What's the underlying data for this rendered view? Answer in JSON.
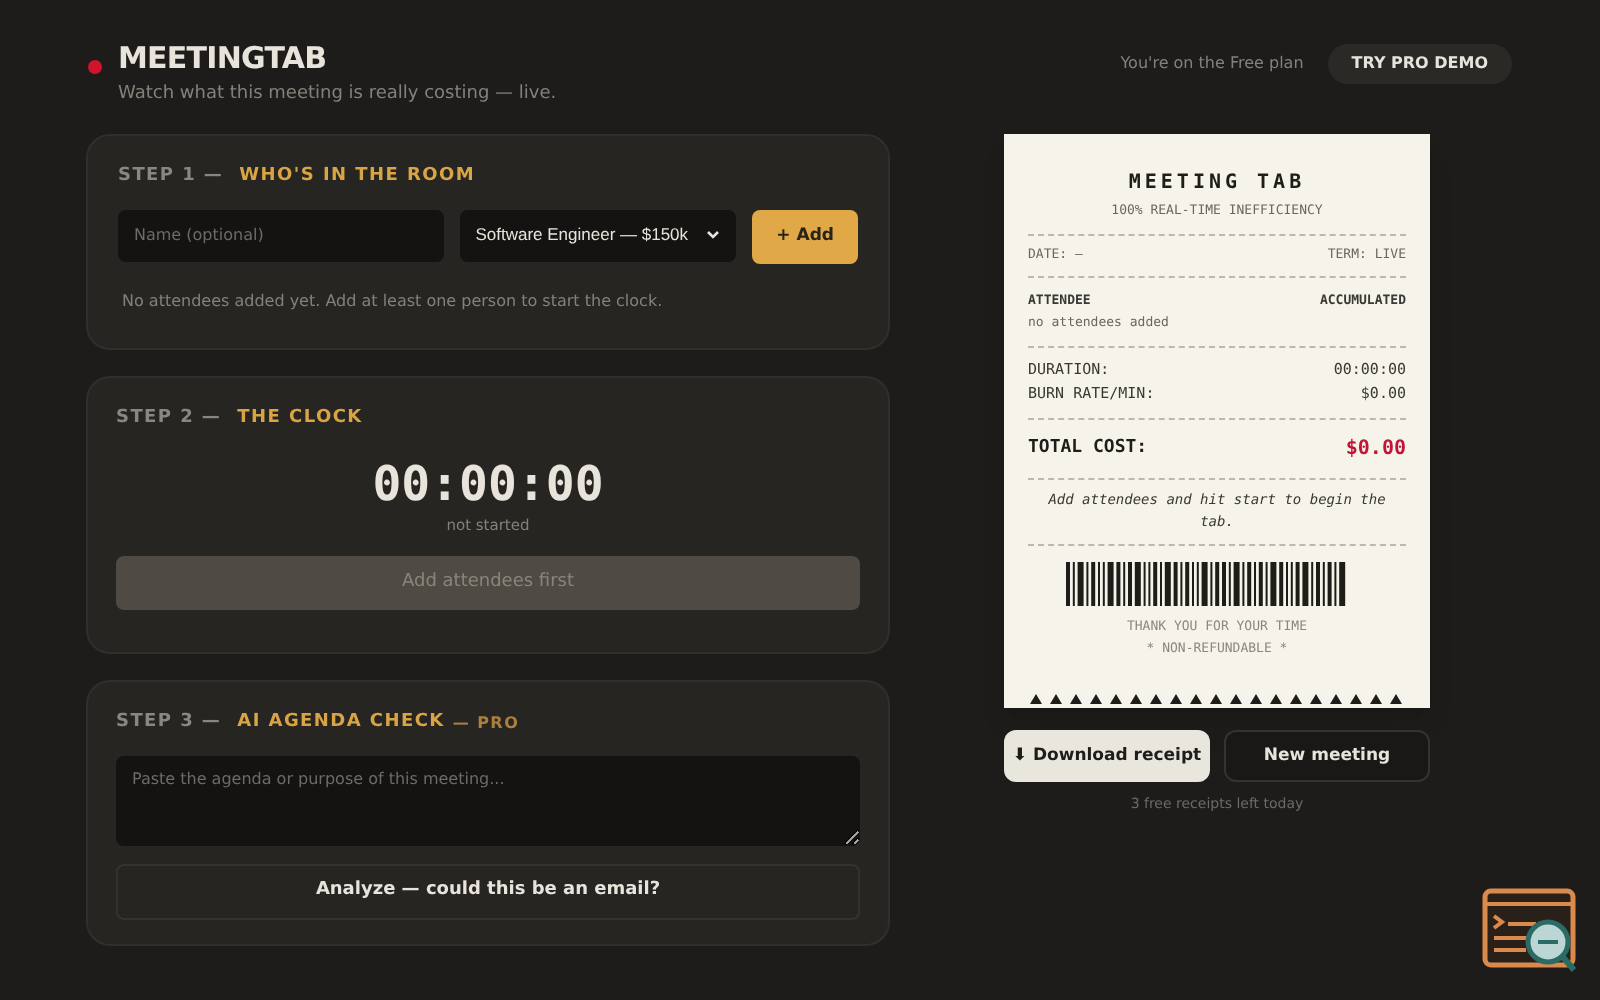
{
  "header": {
    "title": "MEETINGTAB",
    "tagline": "Watch what this meeting is really costing — live.",
    "plan_note": "You're on the Free plan",
    "pro_button": "TRY PRO DEMO"
  },
  "step1": {
    "step": "STEP 1 —",
    "title": "WHO'S IN THE ROOM",
    "name_placeholder": "Name (optional)",
    "role_value": "Software Engineer — $150k",
    "add_button": "+ Add",
    "hint": "No attendees added yet. Add at least one person to start the clock."
  },
  "step2": {
    "step": "STEP 2 —",
    "title": "THE CLOCK",
    "timer": "00:00:00",
    "status": "not started",
    "start_button": "Add attendees first",
    "start_disabled": true
  },
  "step3": {
    "step": "STEP 3 —",
    "title": "AI AGENDA CHECK",
    "badge": "— PRO",
    "agenda_placeholder": "Paste the agenda or purpose of this meeting...",
    "analyze_button": "Analyze — could this be an email?"
  },
  "receipt": {
    "title": "MEETING TAB",
    "subtitle": "100% REAL-TIME INEFFICIENCY",
    "date": "DATE: —",
    "term": "TERM: LIVE",
    "attendee_heading": "ATTENDEE",
    "accumulated_heading": "ACCUMULATED",
    "empty_note": "no attendees added",
    "lines": [
      {
        "label": "DURATION:",
        "value": "00:00:00"
      },
      {
        "label": "BURN RATE/MIN:",
        "value": "$0.00"
      }
    ],
    "total_label": "TOTAL COST:",
    "total_value": "$0.00",
    "message": "Add attendees and hit start to begin the tab.",
    "thanks": "THANK YOU FOR YOUR TIME",
    "footer": "* NON-REFUNDABLE *"
  },
  "actions": {
    "download_button": "⬇ Download receipt",
    "new_button": "New meeting",
    "quota": "3 free receipts left today"
  }
}
